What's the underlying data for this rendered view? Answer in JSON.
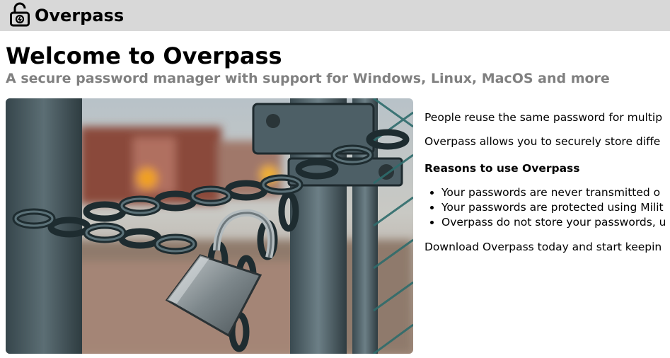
{
  "navbar": {
    "brand_icon": "padlock-icon",
    "brand_name": "Overpass",
    "background": "#d8d8d8"
  },
  "hero": {
    "title": "Welcome to Overpass",
    "subtitle": "A secure password manager with support for Windows, Linux, MacOS and more",
    "subtitle_color": "#808080",
    "image_subject": "padlock-chained-gate-image"
  },
  "content": {
    "intro_1": "People reuse the same password for multip",
    "intro_2": "Overpass allows you to securely store diffe",
    "reasons_heading": "Reasons to use Overpass",
    "reasons": [
      "Your passwords are never transmitted o",
      "Your passwords are protected using Milit",
      "Overpass do not store your passwords, u"
    ],
    "cta": "Download Overpass today and start keepin"
  }
}
